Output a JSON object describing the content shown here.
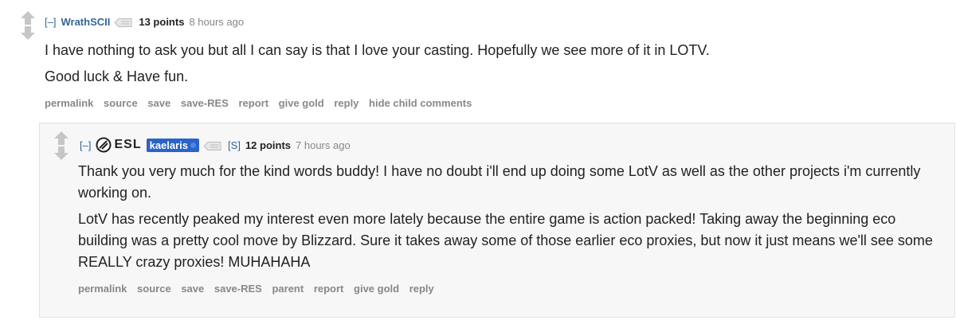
{
  "comment1": {
    "expand": "[–]",
    "author": "WrathSCII",
    "points": "13 points",
    "time": "8 hours ago",
    "paragraphs": [
      "I have nothing to ask you but all I can say is that I love your casting. Hopefully we see more of it in LOTV.",
      "Good luck & Have fun."
    ],
    "buttons": [
      "permalink",
      "source",
      "save",
      "save-RES",
      "report",
      "give gold",
      "reply",
      "hide child comments"
    ]
  },
  "comment2": {
    "expand": "[–]",
    "flair_logo_text": "ESL",
    "author": "kaelaris",
    "submitter_flag": "[S]",
    "points": "12 points",
    "time": "7 hours ago",
    "paragraphs": [
      "Thank you very much for the kind words buddy! I have no doubt i'll end up doing some LotV as well as the other projects i'm currently working on.",
      "LotV has recently peaked my interest even more lately because the entire game is action packed! Taking away the beginning eco building was a pretty cool move by Blizzard. Sure it takes away some of those earlier eco proxies, but now it just means we'll see some REALLY crazy proxies! MUHAHAHA"
    ],
    "buttons": [
      "permalink",
      "source",
      "save",
      "save-RES",
      "parent",
      "report",
      "give gold",
      "reply"
    ]
  },
  "colors": {
    "author": "#336699",
    "flair_bg": "#2a63c9",
    "child_bg": "#f7f7f8",
    "meta": "#888888"
  }
}
